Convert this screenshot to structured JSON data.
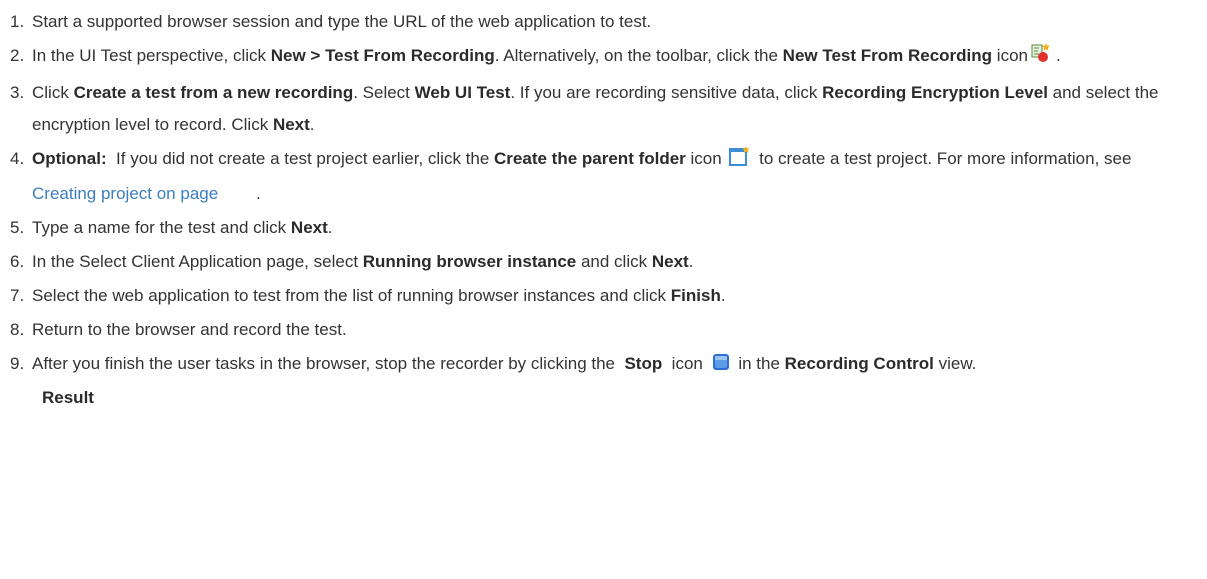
{
  "steps": [
    {
      "num": "1.",
      "p1": "Start a supported browser session and type the URL of the web application to test."
    },
    {
      "num": "2.",
      "p1": "In the UI Test perspective, click ",
      "b1": "New > Test From Recording",
      "p2": ". Alternatively, on the toolbar, click the ",
      "b2": "New Test From Recording",
      "p3": " icon",
      "icon": "new-test-from-recording-icon",
      "p4": "."
    },
    {
      "num": "3.",
      "p1": "Click ",
      "b1": "Create a test from a new recording",
      "p2": ". Select ",
      "b2": "Web UI Test",
      "p3": ". If you are recording sensitive data, click ",
      "b3": "Recording Encryption Level",
      "p4": " and select the encryption level to record. Click ",
      "b4": "Next",
      "p5": "."
    },
    {
      "num": "4.",
      "b1": "Optional:",
      "p1": "  If you did not create a test project earlier, click the ",
      "b2": "Create the parent folder",
      "p2": " icon ",
      "icon": "create-parent-folder-icon",
      "p3": " to create a test project. For more information, see ",
      "link": "Creating project on page",
      "p4": "        ."
    },
    {
      "num": "5.",
      "p1": "Type a name for the test and click ",
      "b1": "Next",
      "p2": "."
    },
    {
      "num": "6.",
      "p1": "In the Select Client Application page, select ",
      "b1": "Running browser instance",
      "p2": " and click ",
      "b2": "Next",
      "p3": "."
    },
    {
      "num": "7.",
      "p1": "Select the web application to test from the list of running browser instances and click ",
      "b1": "Finish",
      "p2": "."
    },
    {
      "num": "8.",
      "p1": "Return to the browser and record the test."
    },
    {
      "num": "9.",
      "p1": "After you finish the user tasks in the browser, stop the recorder by clicking the  ",
      "b1": "Stop",
      "p2": "  icon ",
      "icon": "stop-icon",
      "p3": " in the ",
      "b2": "Recording Control",
      "p4": " view."
    }
  ],
  "result_label": "Result",
  "colors": {
    "text": "#333333",
    "link": "#3c7dbd"
  }
}
